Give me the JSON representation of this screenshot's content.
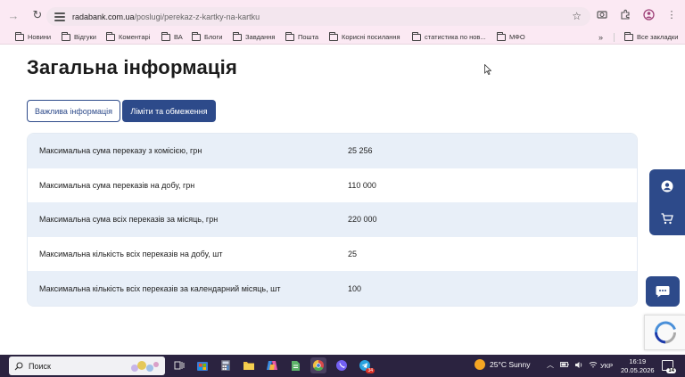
{
  "browser": {
    "url_host": "radabank.com.ua",
    "url_path": "/poslugi/perekaz-z-kartky-na-kartku",
    "bookmarks": [
      "Новини",
      "Відгуки",
      "Коментарі",
      "ВА",
      "Блоги",
      "Завдання",
      "Пошта",
      "Корисні посилання",
      "статистика по нов...",
      "МФО"
    ],
    "all_bookmarks": "Все закладки",
    "more": "»"
  },
  "page": {
    "title": "Загальна інформація",
    "tabs": [
      "Важлива інформація",
      "Ліміти та обмеження"
    ],
    "active_tab": "Ліміти та обмеження",
    "table": [
      {
        "label": "Максимальна сума переказу з комісією, грн",
        "value": "25 256"
      },
      {
        "label": "Максимальна сума переказів на добу, грн",
        "value": "110 000"
      },
      {
        "label": "Максимальна сума всіх переказів за місяць, грн",
        "value": "220 000"
      },
      {
        "label": "Максимальна кількість всіх переказів на добу, шт",
        "value": "25"
      },
      {
        "label": "Максимальна кількість всіх переказів за календарний місяць, шт",
        "value": "100"
      }
    ]
  },
  "taskbar": {
    "search_label": "Поиск",
    "weather": "25°C  Sunny",
    "lang": "УКР",
    "time": "16:19",
    "date": "20.05.2026",
    "telegram_badge": "34",
    "notification_count": "14"
  },
  "colors": {
    "brand": "#2d4a8a",
    "row_alt": "#e8eff8",
    "chrome_bg": "#fbe9f3"
  }
}
